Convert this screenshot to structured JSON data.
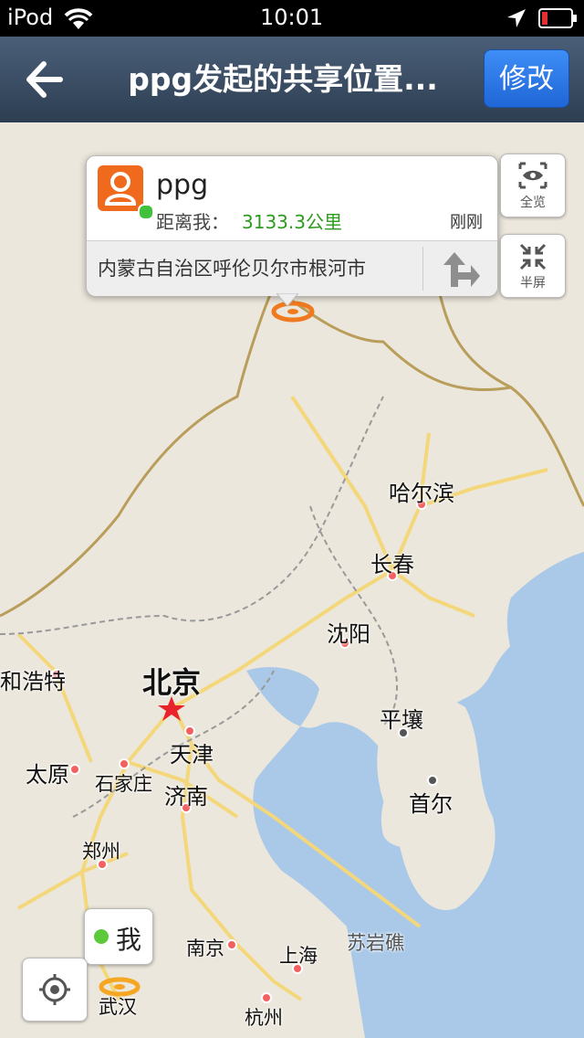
{
  "status_bar": {
    "device": "iPod",
    "time": "10:01"
  },
  "nav": {
    "title": "ppg发起的共享位置...",
    "edit_label": "修改"
  },
  "callout": {
    "name": "ppg",
    "distance_label": "距离我：",
    "distance_value": "3133.3公里",
    "time": "刚刚",
    "address": "内蒙古自治区呼伦贝尔市根河市"
  },
  "side_buttons": {
    "overview_label": "全览",
    "half_screen_label": "半屏"
  },
  "me_label": "我",
  "map": {
    "cities": {
      "harbin": "哈尔滨",
      "changchun": "长春",
      "shenyang": "沈阳",
      "hohhot": "和浩特",
      "beijing": "北京",
      "tianjin": "天津",
      "pyongyang": "平壤",
      "taiyuan": "太原",
      "shijiazhuang": "石家庄",
      "jinan": "济南",
      "seoul": "首尔",
      "zhengzhou": "郑州",
      "suyanjiao": "苏岩礁",
      "nanjing": "南京",
      "shanghai": "上海",
      "wuhan": "武汉",
      "hangzhou": "杭州"
    }
  },
  "colors": {
    "sea": "#aac9e8",
    "land": "#ece7dc",
    "road": "#f3d77a",
    "border": "#b99d5a",
    "accent": "#2a74e4",
    "marker": "#f07a1f"
  }
}
